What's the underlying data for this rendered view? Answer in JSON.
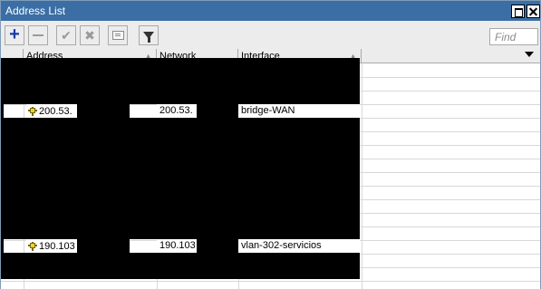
{
  "window": {
    "title": "Address List"
  },
  "toolbar": {
    "buttons": [
      {
        "name": "add",
        "icon": "plus-icon"
      },
      {
        "name": "remove",
        "icon": "minus-icon"
      },
      {
        "name": "enable",
        "icon": "check-icon"
      },
      {
        "name": "disable",
        "icon": "x-icon"
      },
      {
        "name": "comment",
        "icon": "note-icon"
      },
      {
        "name": "filter",
        "icon": "funnel-icon"
      }
    ],
    "find_placeholder": "Find"
  },
  "table": {
    "columns": [
      "",
      "Address",
      "Network",
      "Interface"
    ],
    "rows": [
      {
        "address": "200.53.",
        "network": "200.53.",
        "interface": "bridge-WAN"
      },
      {
        "address": "190.103",
        "network": "190.103",
        "interface": "vlan-302-servicios"
      }
    ]
  },
  "colors": {
    "titlebar": "#3a6ea5",
    "accent_add": "#1a3aa6",
    "redaction": "#000000"
  }
}
